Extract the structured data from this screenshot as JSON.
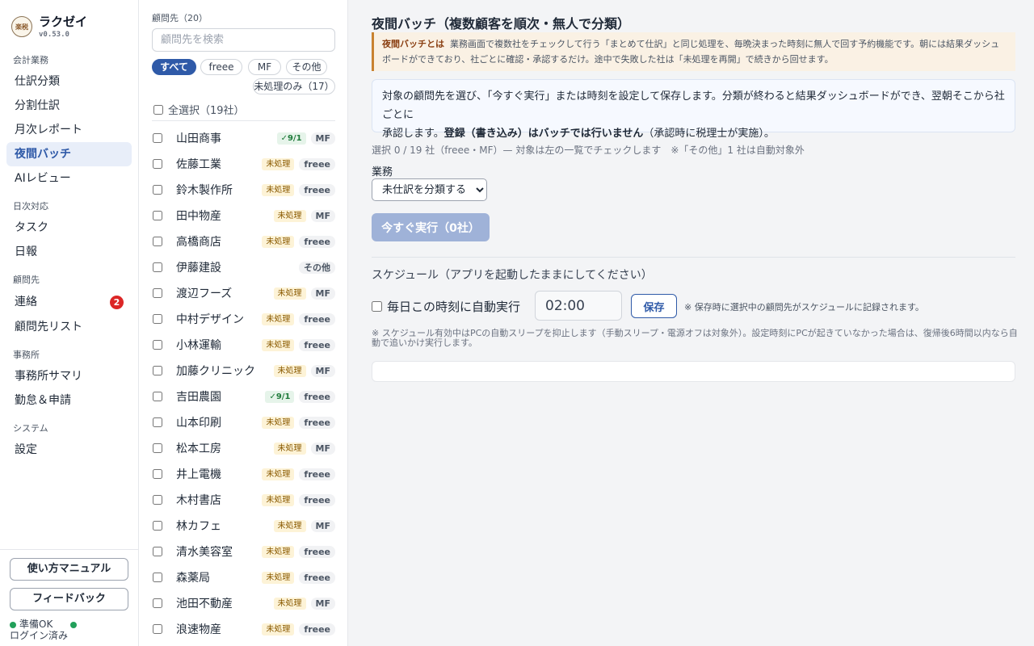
{
  "app": {
    "name": "ラクゼイ",
    "version": "v0.53.0",
    "logo_text": "楽税"
  },
  "sidebar": {
    "sections": [
      {
        "label": "会計業務",
        "items": [
          {
            "label": "仕訳分類"
          },
          {
            "label": "分割仕訳"
          },
          {
            "label": "月次レポート"
          },
          {
            "label": "夜間バッチ",
            "active": true
          },
          {
            "label": "AIレビュー"
          }
        ]
      },
      {
        "label": "日次対応",
        "items": [
          {
            "label": "タスク"
          },
          {
            "label": "日報"
          }
        ]
      },
      {
        "label": "顧問先",
        "items": [
          {
            "label": "連絡",
            "badge": "2"
          },
          {
            "label": "顧問先リスト"
          }
        ]
      },
      {
        "label": "事務所",
        "items": [
          {
            "label": "事務所サマリ"
          },
          {
            "label": "勤怠＆申請"
          }
        ]
      },
      {
        "label": "システム",
        "items": [
          {
            "label": "設定"
          }
        ]
      }
    ],
    "manual_button": "使い方マニュアル",
    "feedback_button": "フィードバック",
    "status_ready": "準備OK",
    "status_login": "ログイン済み"
  },
  "clients": {
    "title": "顧問先（20）",
    "search_placeholder": "顧問先を検索",
    "filters": [
      "すべて",
      "freee",
      "MF",
      "その他"
    ],
    "unprocessed_filter": "未処理のみ（17）",
    "select_all": "全選択（19社）",
    "rows": [
      {
        "name": "山田商事",
        "status": "✓9/1",
        "status_type": "done",
        "software": "MF"
      },
      {
        "name": "佐藤工業",
        "status": "未処理",
        "status_type": "pending",
        "software": "freee"
      },
      {
        "name": "鈴木製作所",
        "status": "未処理",
        "status_type": "pending",
        "software": "freee"
      },
      {
        "name": "田中物産",
        "status": "未処理",
        "status_type": "pending",
        "software": "MF"
      },
      {
        "name": "高橋商店",
        "status": "未処理",
        "status_type": "pending",
        "software": "freee"
      },
      {
        "name": "伊藤建設",
        "status": "",
        "status_type": "none",
        "software": "その他"
      },
      {
        "name": "渡辺フーズ",
        "status": "未処理",
        "status_type": "pending",
        "software": "MF"
      },
      {
        "name": "中村デザイン",
        "status": "未処理",
        "status_type": "pending",
        "software": "freee"
      },
      {
        "name": "小林運輸",
        "status": "未処理",
        "status_type": "pending",
        "software": "freee"
      },
      {
        "name": "加藤クリニック",
        "status": "未処理",
        "status_type": "pending",
        "software": "MF"
      },
      {
        "name": "吉田農園",
        "status": "✓9/1",
        "status_type": "done",
        "software": "freee"
      },
      {
        "name": "山本印刷",
        "status": "未処理",
        "status_type": "pending",
        "software": "freee"
      },
      {
        "name": "松本工房",
        "status": "未処理",
        "status_type": "pending",
        "software": "MF"
      },
      {
        "name": "井上電機",
        "status": "未処理",
        "status_type": "pending",
        "software": "freee"
      },
      {
        "name": "木村書店",
        "status": "未処理",
        "status_type": "pending",
        "software": "freee"
      },
      {
        "name": "林カフェ",
        "status": "未処理",
        "status_type": "pending",
        "software": "MF"
      },
      {
        "name": "清水美容室",
        "status": "未処理",
        "status_type": "pending",
        "software": "freee"
      },
      {
        "name": "森薬局",
        "status": "未処理",
        "status_type": "pending",
        "software": "freee"
      },
      {
        "name": "池田不動産",
        "status": "未処理",
        "status_type": "pending",
        "software": "MF"
      },
      {
        "name": "浪速物産",
        "status": "未処理",
        "status_type": "pending",
        "software": "freee"
      }
    ]
  },
  "main": {
    "title": "夜間バッチ（複数顧客を順次・無人で分類）",
    "info_label": "夜間バッチとは",
    "info_text": "業務画面で複数社をチェックして行う「まとめて仕訳」と同じ処理を、毎晩決まった時刻に無人で回す予約機能です。朝には結果ダッシュボードができており、社ごとに確認・承認するだけ。途中で失敗した社は「未処理を再開」で続きから回せます。",
    "desc_line1": "対象の顧問先を選び、「今すぐ実行」または時刻を設定して保存します。分類が終わると結果ダッシュボードができ、翌朝そこから社ごとに",
    "desc_line2_prefix": "承認します。",
    "desc_line2_bold": "登録（書き込み）はバッチでは行いません",
    "desc_line2_suffix": "（承認時に税理士が実施）。",
    "selection_count": "選択 0 / 19 社（freee・MF）— 対象は左の一覧でチェックします　※「その他」1 社は自動対象外",
    "task_label": "業務",
    "task_option": "未仕訳を分類する",
    "run_button": "今すぐ実行（0社）",
    "schedule_title": "スケジュール（アプリを起動したままにしてください）",
    "schedule_checkbox": "毎日この時刻に自動実行",
    "schedule_time": "02:00",
    "save_button": "保存",
    "save_note": "※ 保存時に選択中の顧問先がスケジュールに記録されます。",
    "schedule_note": "※ スケジュール有効中はPCの自動スリープを抑止します（手動スリープ・電源オフは対象外）。設定時刻にPCが起きていなかった場合は、復帰後6時間以内なら自動で追いかけ実行します。"
  }
}
